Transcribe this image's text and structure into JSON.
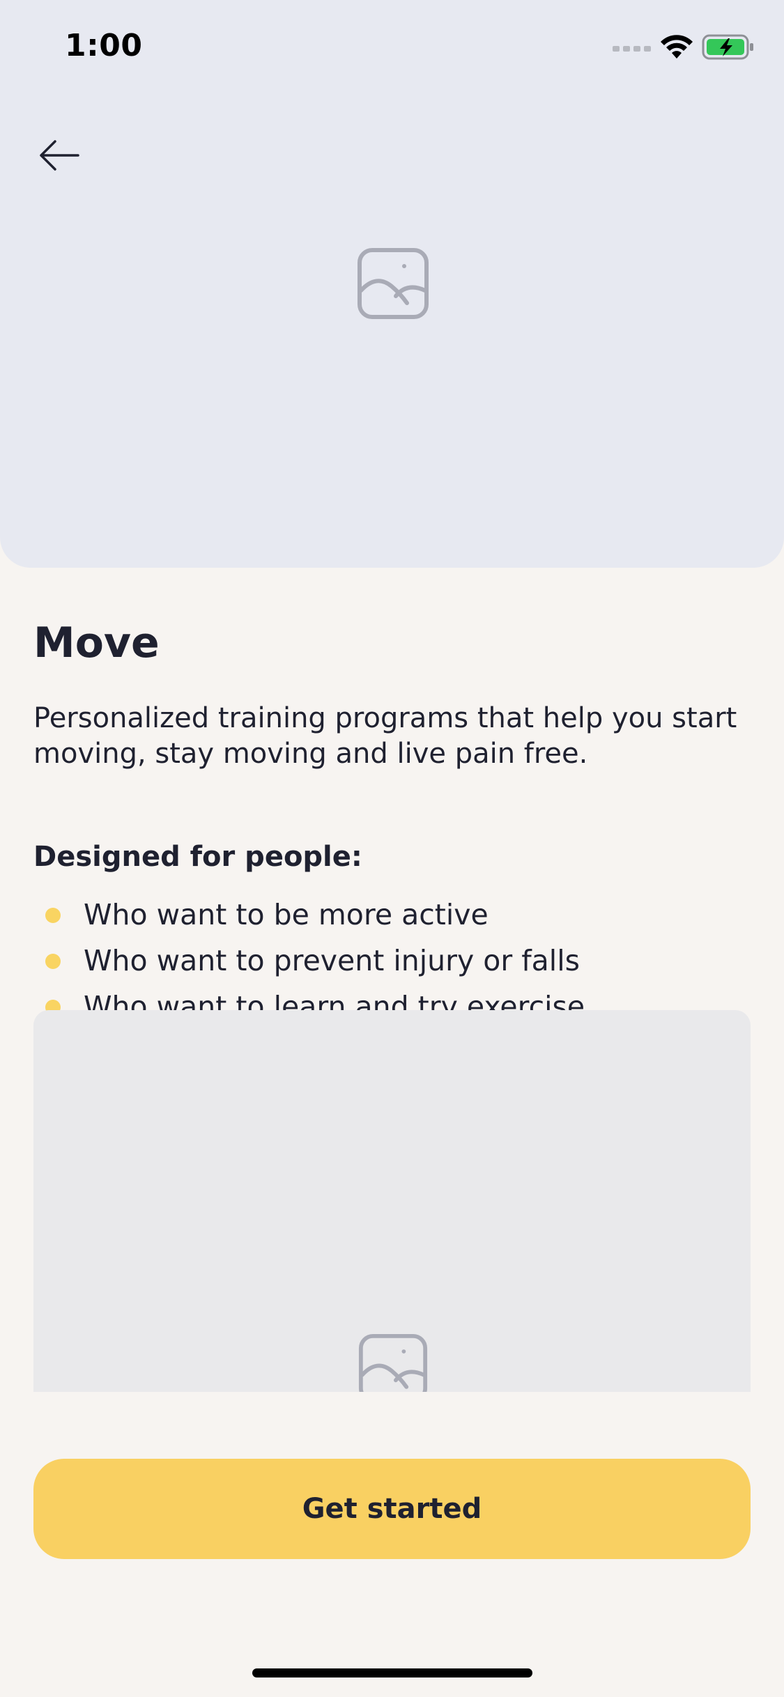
{
  "status_bar": {
    "time": "1:00",
    "icons": [
      "signal-icon",
      "wifi-icon",
      "battery-charging-icon"
    ],
    "battery_color": "#34C759"
  },
  "header": {
    "back_icon": "arrow-left-icon"
  },
  "hero": {
    "image_icon": "image-placeholder-icon",
    "background": "#E7E9F1"
  },
  "content": {
    "title": "Move",
    "description": "Personalized training programs that help you start moving, stay moving and live pain free.",
    "designed_for_label": "Designed for people:",
    "designed_for_items": [
      "Who want to be more active",
      "Who want to prevent injury or falls",
      "Who want to learn and try exercise"
    ],
    "bullet_color": "#F9D462"
  },
  "media": {
    "image_icon": "image-placeholder-icon",
    "background": "#E9E9EB"
  },
  "cta": {
    "label": "Get started",
    "color": "#F9D062"
  }
}
